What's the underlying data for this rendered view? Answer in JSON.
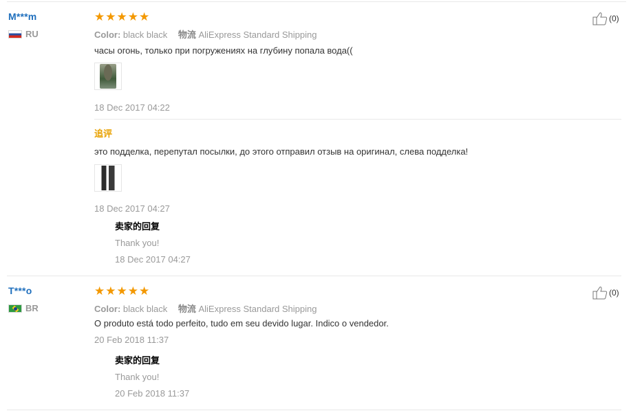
{
  "reviews": [
    {
      "user": "M***m",
      "country": "RU",
      "stars": 5,
      "color_label": "Color:",
      "color_value": "black black",
      "ship_label": "物流",
      "shipping": "AliExpress Standard Shipping",
      "text": "часы огонь, только при погружениях на глубину попала вода((",
      "date": "18 Dec 2017 04:22",
      "helpful_count": "(0)",
      "additional_label": "追评",
      "additional_text": "это подделка, перепутал посылки, до этого отправил отзыв на оригинал, слева подделка!",
      "additional_date": "18 Dec 2017 04:27",
      "reply_title": "卖家的回复",
      "reply_text": "Thank you!",
      "reply_date": "18 Dec 2017 04:27"
    },
    {
      "user": "T***o",
      "country": "BR",
      "stars": 5,
      "color_label": "Color:",
      "color_value": "black black",
      "ship_label": "物流",
      "shipping": "AliExpress Standard Shipping",
      "text": "O produto está todo perfeito, tudo em seu devido lugar. Indico o vendedor.",
      "date": "20 Feb 2018 11:37",
      "helpful_count": "(0)",
      "reply_title": "卖家的回复",
      "reply_text": "Thank you!",
      "reply_date": "20 Feb 2018 11:37"
    }
  ],
  "colors": {
    "username": "#1f6fbd",
    "star": "#f39800",
    "additional": "#e8a100",
    "muted": "#999999"
  },
  "icons": [
    "thumbs-up-icon",
    "star-icon",
    "flag-ru-icon",
    "flag-br-icon"
  ]
}
